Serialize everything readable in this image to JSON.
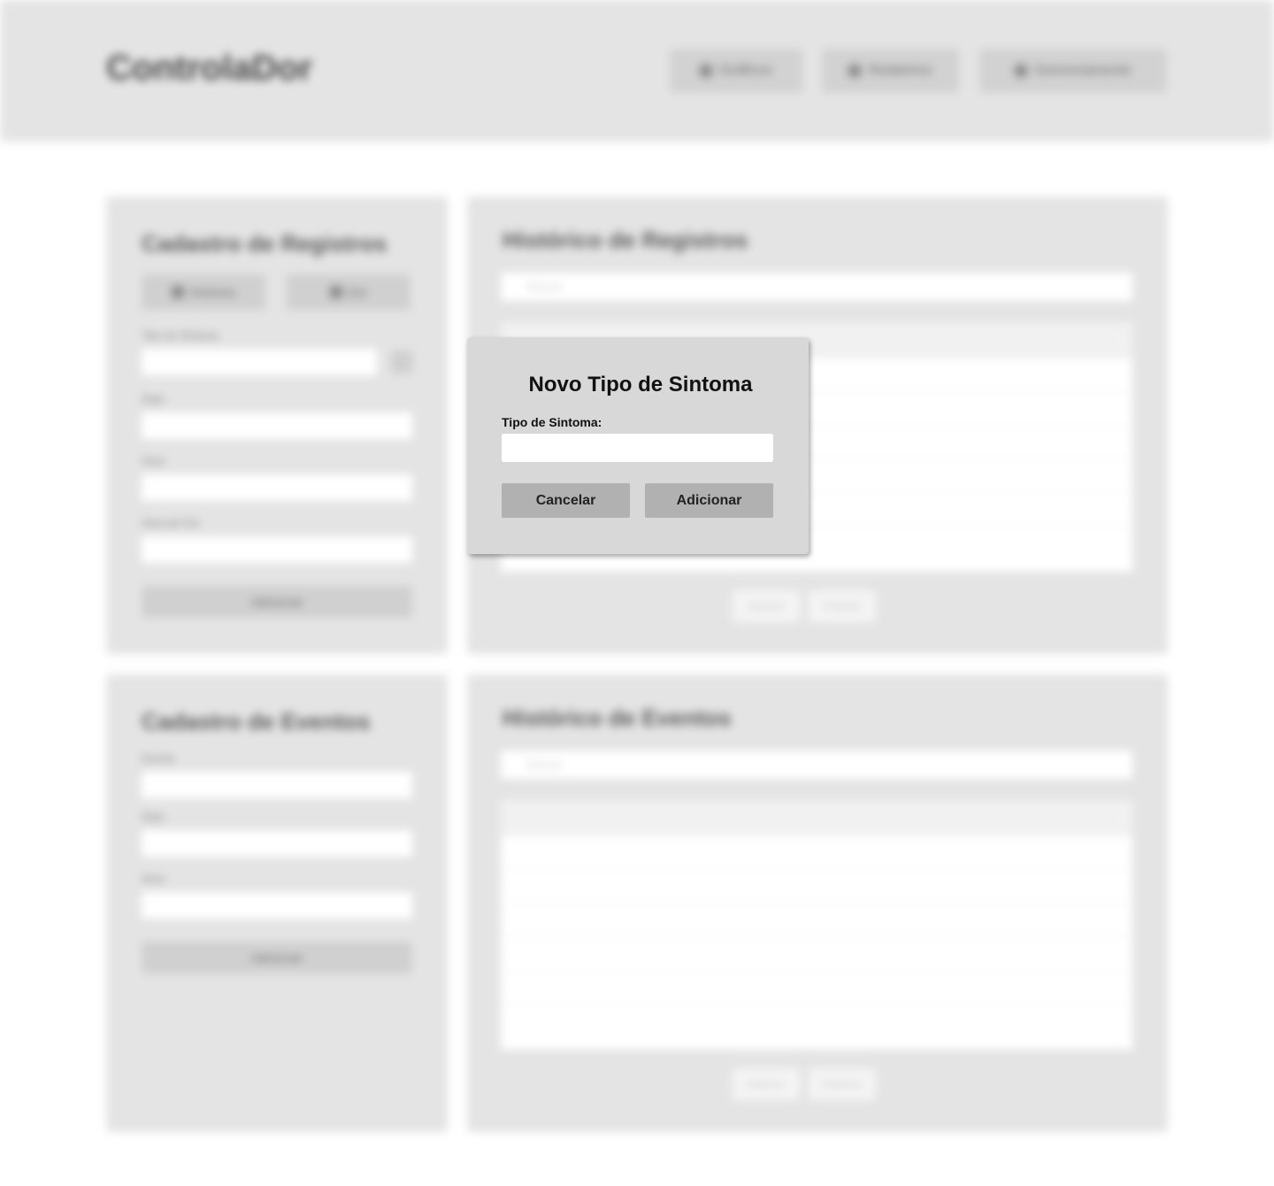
{
  "header": {
    "brand": "ControlaDor",
    "nav": [
      {
        "label": "Gráficos",
        "icon": "chart-icon"
      },
      {
        "label": "Relatórios",
        "icon": "document-icon"
      },
      {
        "label": "Gerenciamento",
        "icon": "settings-icon"
      }
    ]
  },
  "registros_form": {
    "title": "Cadastro de Registros",
    "tabs": [
      "Sintoma",
      "Dor"
    ],
    "fields": [
      "Tipo de Sintoma",
      "Data",
      "Hora",
      "Hora de Fim"
    ],
    "submit_label": "Adicionar"
  },
  "registros_history": {
    "title": "Histórico de Registros",
    "search_placeholder": "Buscar",
    "pager": [
      "Anterior",
      "Próximo"
    ]
  },
  "eventos_form": {
    "title": "Cadastro de Eventos",
    "fields": [
      "Evento",
      "Data",
      "Hora"
    ],
    "submit_label": "Adicionar"
  },
  "eventos_history": {
    "title": "Histórico de Eventos",
    "search_placeholder": "Buscar",
    "pager": [
      "Anterior",
      "Próximo"
    ]
  },
  "modal": {
    "title": "Novo Tipo de Sintoma",
    "field_label": "Tipo de Sintoma:",
    "field_value": "",
    "cancel_label": "Cancelar",
    "add_label": "Adicionar"
  }
}
